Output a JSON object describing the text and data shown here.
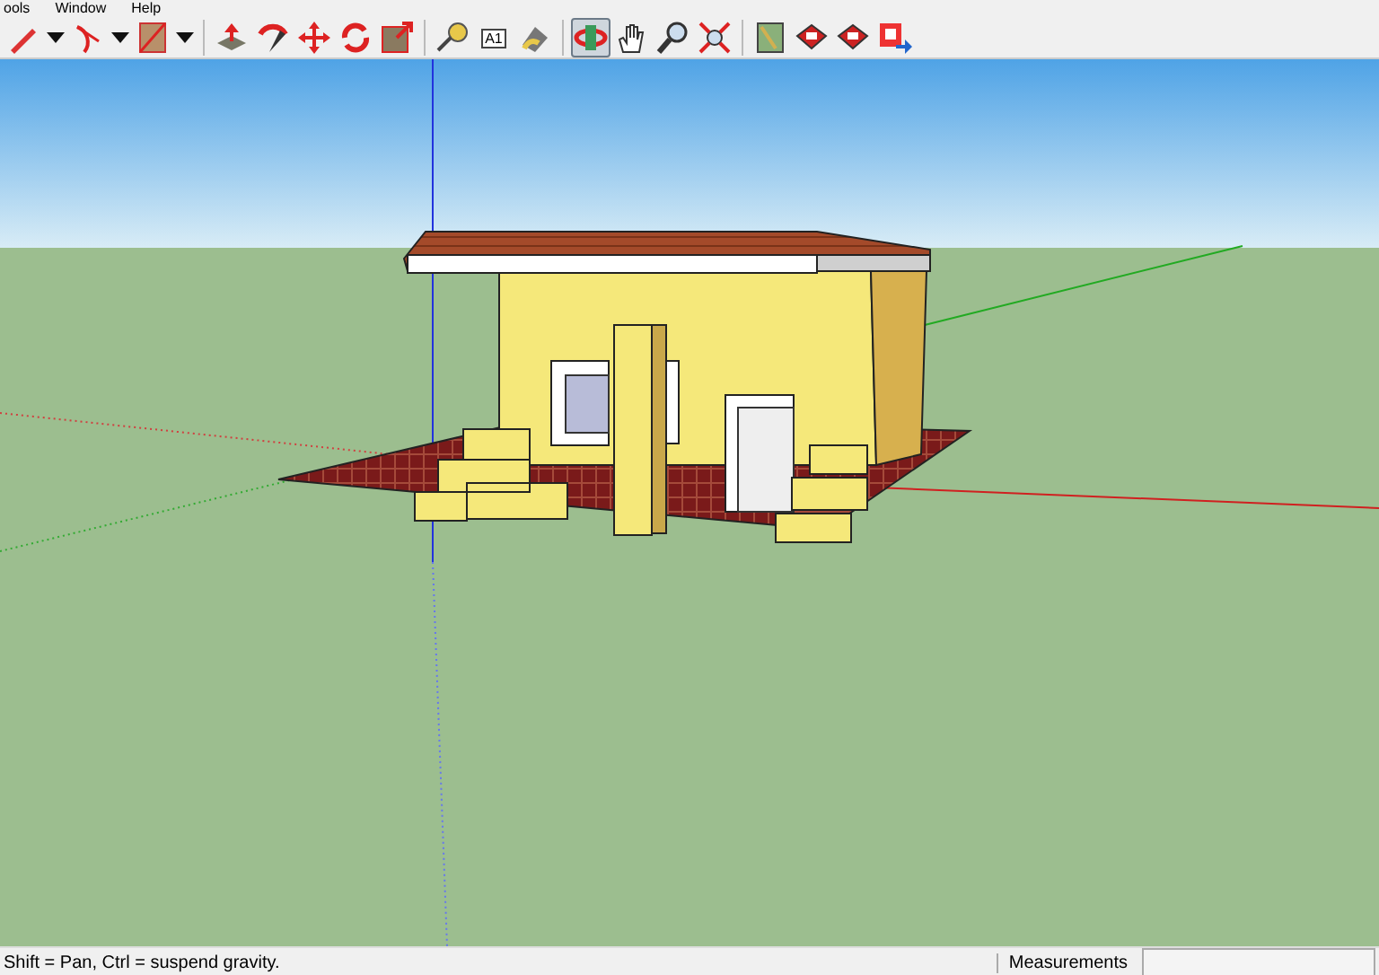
{
  "menu_bar": {
    "items": [
      "ools",
      "Window",
      "Help"
    ]
  },
  "toolbar": {
    "groups": [
      [
        {
          "kind": "pencil",
          "selected": false
        },
        {
          "kind": "caret",
          "selected": false
        },
        {
          "kind": "arc",
          "selected": false
        },
        {
          "kind": "caret",
          "selected": false
        },
        {
          "kind": "rectangle",
          "selected": false
        },
        {
          "kind": "caret",
          "selected": false
        }
      ],
      [
        {
          "kind": "pushpull",
          "selected": false
        },
        {
          "kind": "followme",
          "selected": false
        },
        {
          "kind": "move",
          "selected": false
        },
        {
          "kind": "rotate",
          "selected": false
        },
        {
          "kind": "scale",
          "selected": false
        }
      ],
      [
        {
          "kind": "tape",
          "selected": false
        },
        {
          "kind": "text",
          "selected": false,
          "label": "A1"
        },
        {
          "kind": "paint",
          "selected": false
        }
      ],
      [
        {
          "kind": "orbit",
          "selected": true
        },
        {
          "kind": "pan",
          "selected": false
        },
        {
          "kind": "zoom",
          "selected": false
        },
        {
          "kind": "extents",
          "selected": false
        }
      ],
      [
        {
          "kind": "map",
          "selected": false
        },
        {
          "kind": "warehouse",
          "selected": false
        },
        {
          "kind": "warehouse",
          "selected": false
        },
        {
          "kind": "share",
          "selected": false
        }
      ]
    ]
  },
  "status_bar": {
    "hint": "Shift = Pan, Ctrl = suspend gravity.",
    "measurements_label": "Measurements"
  }
}
